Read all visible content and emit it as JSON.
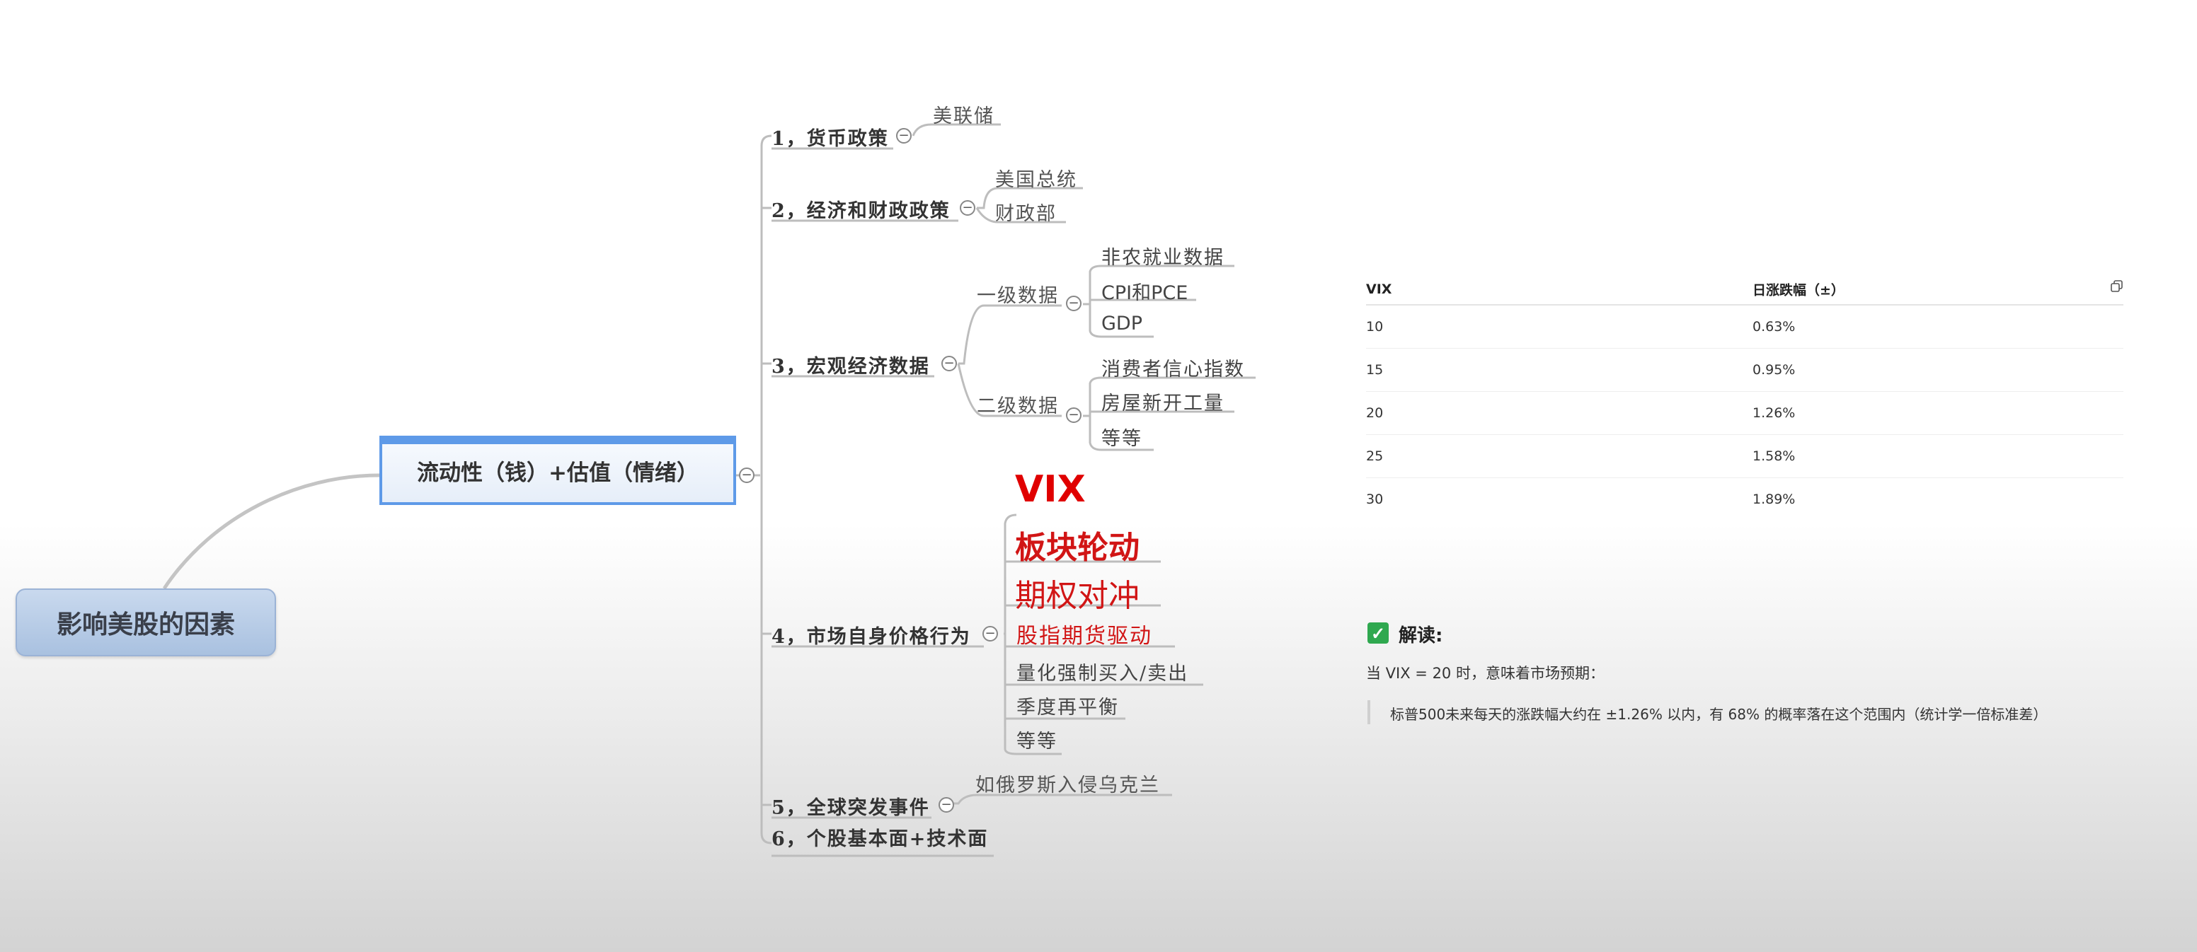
{
  "mindmap": {
    "root": "影响美股的因素",
    "center": "流动性（钱）+估值（情绪）",
    "branches": {
      "b1": {
        "label": "1，货币政策",
        "children": [
          "美联储"
        ]
      },
      "b2": {
        "label": "2，经济和财政政策",
        "children": [
          "美国总统",
          "财政部"
        ]
      },
      "b3": {
        "label": "3，宏观经济数据",
        "primary": {
          "label": "一级数据",
          "children": [
            "非农就业数据",
            "CPI和PCE",
            "GDP"
          ]
        },
        "secondary": {
          "label": "二级数据",
          "children": [
            "消费者信心指数",
            "房屋新开工量",
            "等等"
          ]
        }
      },
      "b4": {
        "label": "4，市场自身价格行为",
        "vix": "VIX",
        "children": [
          "板块轮动",
          "期权对冲",
          "股指期货驱动",
          "量化强制买入/卖出",
          "季度再平衡",
          "等等"
        ]
      },
      "b5": {
        "label": "5，全球突发事件",
        "children": [
          "如俄罗斯入侵乌克兰"
        ]
      },
      "b6": {
        "label": "6，个股基本面+技术面"
      }
    }
  },
  "table": {
    "headers": [
      "VIX",
      "日涨跌幅（±）"
    ],
    "rows": [
      [
        "10",
        "0.63%"
      ],
      [
        "15",
        "0.95%"
      ],
      [
        "20",
        "1.26%"
      ],
      [
        "25",
        "1.58%"
      ],
      [
        "30",
        "1.89%"
      ]
    ]
  },
  "interpretation": {
    "title": "解读:",
    "line1": "当 VIX = 20 时，意味着市场预期：",
    "quote": "标普500未来每天的涨跌幅大约在 ±1.26% 以内，有 68% 的概率落在这个范围内（统计学一倍标准差）"
  },
  "icons": {
    "collapse": "collapse-icon",
    "copy": "copy-icon",
    "check": "check-icon"
  },
  "colors": {
    "accent_red": "#d11515",
    "node_blue": "#5e9ae8",
    "check_green": "#2fa84f"
  }
}
